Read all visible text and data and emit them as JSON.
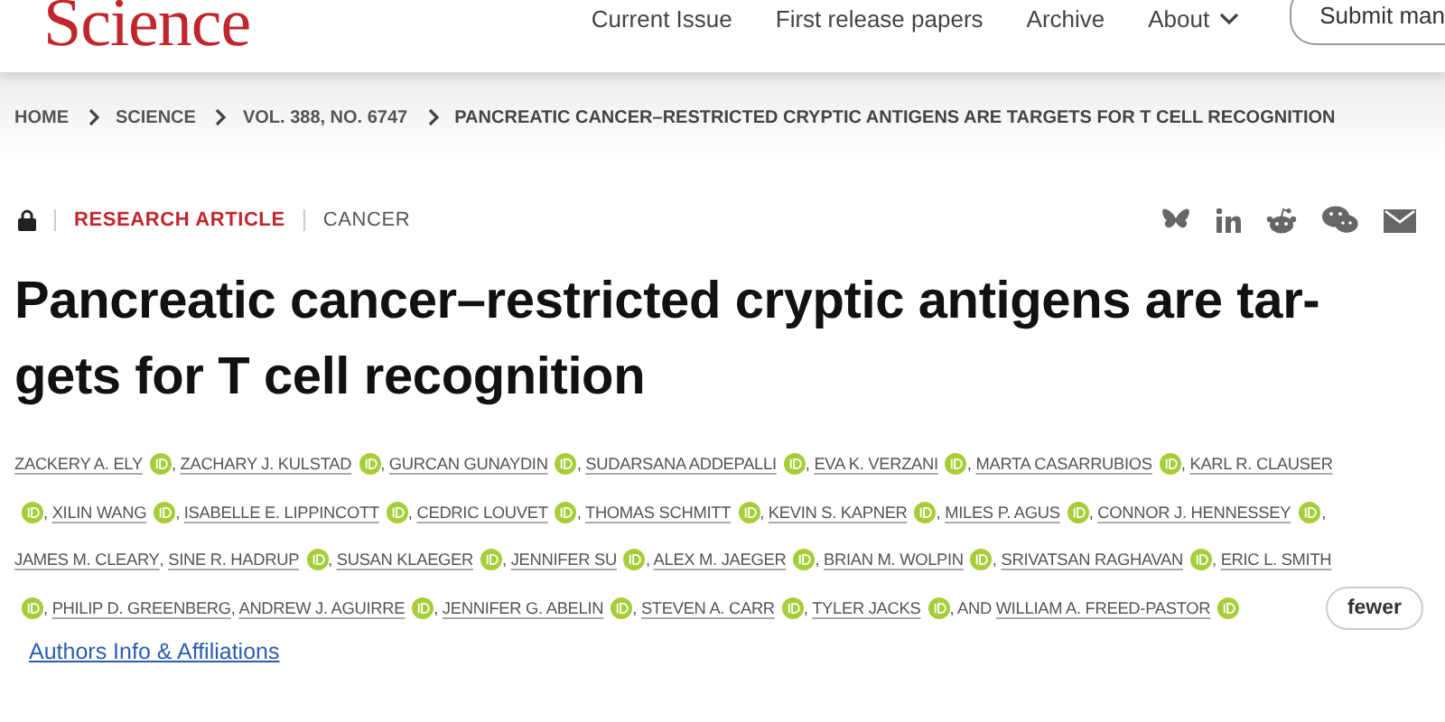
{
  "header": {
    "logo": "Science",
    "nav": [
      {
        "label": "Current Issue",
        "kind": "link"
      },
      {
        "label": "First release papers",
        "kind": "link"
      },
      {
        "label": "Archive",
        "kind": "link"
      },
      {
        "label": "About",
        "kind": "menu"
      }
    ],
    "submit_button": "Submit man"
  },
  "breadcrumb": [
    "HOME",
    "SCIENCE",
    "VOL. 388, NO. 6747",
    "PANCREATIC CANCER–RESTRICTED CRYPTIC ANTIGENS ARE TARGETS FOR T CELL RECOGNITION"
  ],
  "article_meta": {
    "locked": true,
    "type": "RESEARCH ARTICLE",
    "section": "CANCER"
  },
  "share_icons": [
    {
      "kind": "bluesky"
    },
    {
      "kind": "linkedin"
    },
    {
      "kind": "reddit"
    },
    {
      "kind": "wechat"
    },
    {
      "kind": "email"
    }
  ],
  "title": "Pancreatic cancer–restricted cryptic antigens are tar-\ngets for T cell recognition",
  "author_lines": [
    [
      {
        "kind": "author",
        "text": "ZACKERY A. ELY"
      },
      {
        "kind": "orcid"
      },
      {
        "kind": "sep",
        "text": ","
      },
      {
        "kind": "author",
        "text": "ZACHARY J. KULSTAD"
      },
      {
        "kind": "orcid"
      },
      {
        "kind": "sep",
        "text": ","
      },
      {
        "kind": "author",
        "text": "GURCAN GUNAYDIN"
      },
      {
        "kind": "orcid"
      },
      {
        "kind": "sep",
        "text": ","
      },
      {
        "kind": "author",
        "text": "SUDARSANA ADDEPALLI"
      },
      {
        "kind": "orcid"
      },
      {
        "kind": "sep",
        "text": ","
      },
      {
        "kind": "author",
        "text": "EVA K. VERZANI"
      },
      {
        "kind": "orcid"
      },
      {
        "kind": "sep",
        "text": ","
      },
      {
        "kind": "author",
        "text": "MARTA CASARRUBIOS"
      },
      {
        "kind": "orcid"
      },
      {
        "kind": "sep",
        "text": ","
      },
      {
        "kind": "author",
        "text": "KARL R. CLAUSER"
      }
    ],
    [
      {
        "kind": "orcid"
      },
      {
        "kind": "sep",
        "text": ","
      },
      {
        "kind": "author",
        "text": "XILIN WANG"
      },
      {
        "kind": "orcid"
      },
      {
        "kind": "sep",
        "text": ","
      },
      {
        "kind": "author",
        "text": "ISABELLE E. LIPPINCOTT"
      },
      {
        "kind": "orcid"
      },
      {
        "kind": "sep",
        "text": ","
      },
      {
        "kind": "author",
        "text": "CEDRIC LOUVET"
      },
      {
        "kind": "orcid"
      },
      {
        "kind": "sep",
        "text": ","
      },
      {
        "kind": "author",
        "text": "THOMAS SCHMITT"
      },
      {
        "kind": "orcid"
      },
      {
        "kind": "sep",
        "text": ","
      },
      {
        "kind": "author",
        "text": "KEVIN S. KAPNER"
      },
      {
        "kind": "orcid"
      },
      {
        "kind": "sep",
        "text": ","
      },
      {
        "kind": "author",
        "text": "MILES P. AGUS"
      },
      {
        "kind": "orcid"
      },
      {
        "kind": "sep",
        "text": ","
      },
      {
        "kind": "author",
        "text": "CONNOR J. HENNESSEY"
      },
      {
        "kind": "orcid"
      },
      {
        "kind": "sep",
        "text": ","
      }
    ],
    [
      {
        "kind": "author",
        "text": "JAMES M. CLEARY"
      },
      {
        "kind": "sep",
        "text": ","
      },
      {
        "kind": "author",
        "text": "SINE R. HADRUP"
      },
      {
        "kind": "orcid"
      },
      {
        "kind": "sep",
        "text": ","
      },
      {
        "kind": "author",
        "text": "SUSAN KLAEGER"
      },
      {
        "kind": "orcid"
      },
      {
        "kind": "sep",
        "text": ","
      },
      {
        "kind": "author",
        "text": "JENNIFER SU"
      },
      {
        "kind": "orcid"
      },
      {
        "kind": "sep",
        "text": ","
      },
      {
        "kind": "author",
        "text": "ALEX M. JAEGER"
      },
      {
        "kind": "orcid"
      },
      {
        "kind": "sep",
        "text": ","
      },
      {
        "kind": "author",
        "text": "BRIAN M. WOLPIN"
      },
      {
        "kind": "orcid"
      },
      {
        "kind": "sep",
        "text": ","
      },
      {
        "kind": "author",
        "text": "SRIVATSAN RAGHAVAN"
      },
      {
        "kind": "orcid"
      },
      {
        "kind": "sep",
        "text": ","
      },
      {
        "kind": "author",
        "text": "ERIC L. SMITH"
      }
    ],
    [
      {
        "kind": "orcid"
      },
      {
        "kind": "sep",
        "text": ","
      },
      {
        "kind": "author",
        "text": "PHILIP D. GREENBERG"
      },
      {
        "kind": "sep",
        "text": ","
      },
      {
        "kind": "author",
        "text": "ANDREW J. AGUIRRE"
      },
      {
        "kind": "orcid"
      },
      {
        "kind": "sep",
        "text": ","
      },
      {
        "kind": "author",
        "text": "JENNIFER G. ABELIN"
      },
      {
        "kind": "orcid"
      },
      {
        "kind": "sep",
        "text": ","
      },
      {
        "kind": "author",
        "text": "STEVEN A. CARR"
      },
      {
        "kind": "orcid"
      },
      {
        "kind": "sep",
        "text": ","
      },
      {
        "kind": "author",
        "text": "TYLER JACKS"
      },
      {
        "kind": "orcid"
      },
      {
        "kind": "sep",
        "text": ", AND"
      },
      {
        "kind": "author",
        "text": "WILLIAM A. FREED-PASTOR"
      },
      {
        "kind": "orcid"
      },
      {
        "kind": "button",
        "text": "fewer"
      }
    ]
  ],
  "affiliations_link": "Authors Info & Affiliations"
}
